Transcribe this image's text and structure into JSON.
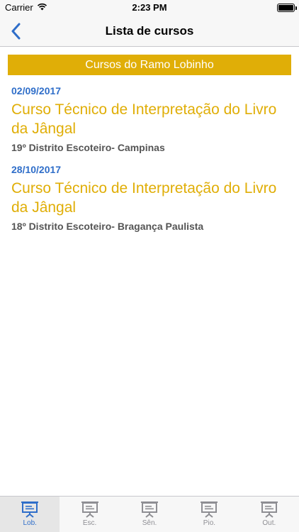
{
  "status_bar": {
    "carrier": "Carrier",
    "time": "2:23 PM",
    "wifi_icon": "wifi-icon",
    "battery_icon": "battery-icon"
  },
  "nav": {
    "title": "Lista de cursos",
    "back_icon": "chevron-left-icon"
  },
  "section": {
    "header": "Cursos do Ramo Lobinho"
  },
  "courses": [
    {
      "date": "02/09/2017",
      "title": "Curso Técnico de Interpretação do Livro da Jângal",
      "district": "19º Distrito Escoteiro- Campinas"
    },
    {
      "date": "28/10/2017",
      "title": "Curso Técnico de Interpretação do Livro da Jângal",
      "district": "18º Distrito Escoteiro- Bragança Paulista"
    }
  ],
  "tabs": [
    {
      "label": "Lob.",
      "icon": "presentation-board-icon",
      "active": true
    },
    {
      "label": "Esc.",
      "icon": "presentation-board-icon",
      "active": false
    },
    {
      "label": "Sên.",
      "icon": "presentation-board-icon",
      "active": false
    },
    {
      "label": "Pio.",
      "icon": "presentation-board-icon",
      "active": false
    },
    {
      "label": "Out.",
      "icon": "presentation-board-icon",
      "active": false
    }
  ],
  "colors": {
    "accent_gold": "#e0ae07",
    "accent_blue": "#2f6ec9",
    "tab_inactive": "#8e8e93"
  }
}
